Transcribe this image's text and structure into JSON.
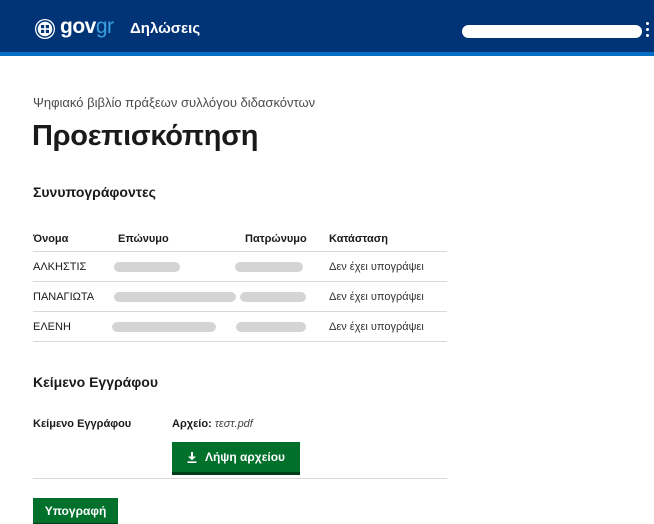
{
  "header": {
    "logo_gov": "gov",
    "logo_gr": "gr",
    "app_title": "Δηλώσεις",
    "user_name": "",
    "menu_icon": "kebab-icon",
    "colors": {
      "bar": "#003476",
      "accent": "#046ec5"
    }
  },
  "page": {
    "subtitle": "Ψηφιακό βιβλίο πράξεων συλλόγου διδασκόντων",
    "title": "Προεπισκόπηση"
  },
  "cosigners": {
    "heading": "Συνυπογράφοντες",
    "columns": [
      "Όνομα",
      "Επώνυμο",
      "Πατρώνυμο",
      "Κατάσταση"
    ],
    "rows": [
      {
        "name": "ΑΛΚΗΣΤΙΣ",
        "surname": "",
        "father": "",
        "status": "Δεν έχει υπογράψει"
      },
      {
        "name": "ΠΑΝΑΓΙΩΤΑ",
        "surname": "",
        "father": "",
        "status": "Δεν έχει υπογράψει"
      },
      {
        "name": "ΕΛΕΝΗ",
        "surname": "",
        "father": "",
        "status": "Δεν έχει υπογράψει"
      }
    ]
  },
  "document": {
    "heading": "Κείμενο Εγγράφου",
    "label": "Κείμενο Εγγράφου",
    "file_key": "Αρχείο:",
    "file_name": "τεστ.pdf",
    "download_label": "Λήψη αρχείου",
    "download_icon": "download-icon"
  },
  "actions": {
    "sign_label": "Υπογραφή",
    "button_color": "#00702b"
  }
}
